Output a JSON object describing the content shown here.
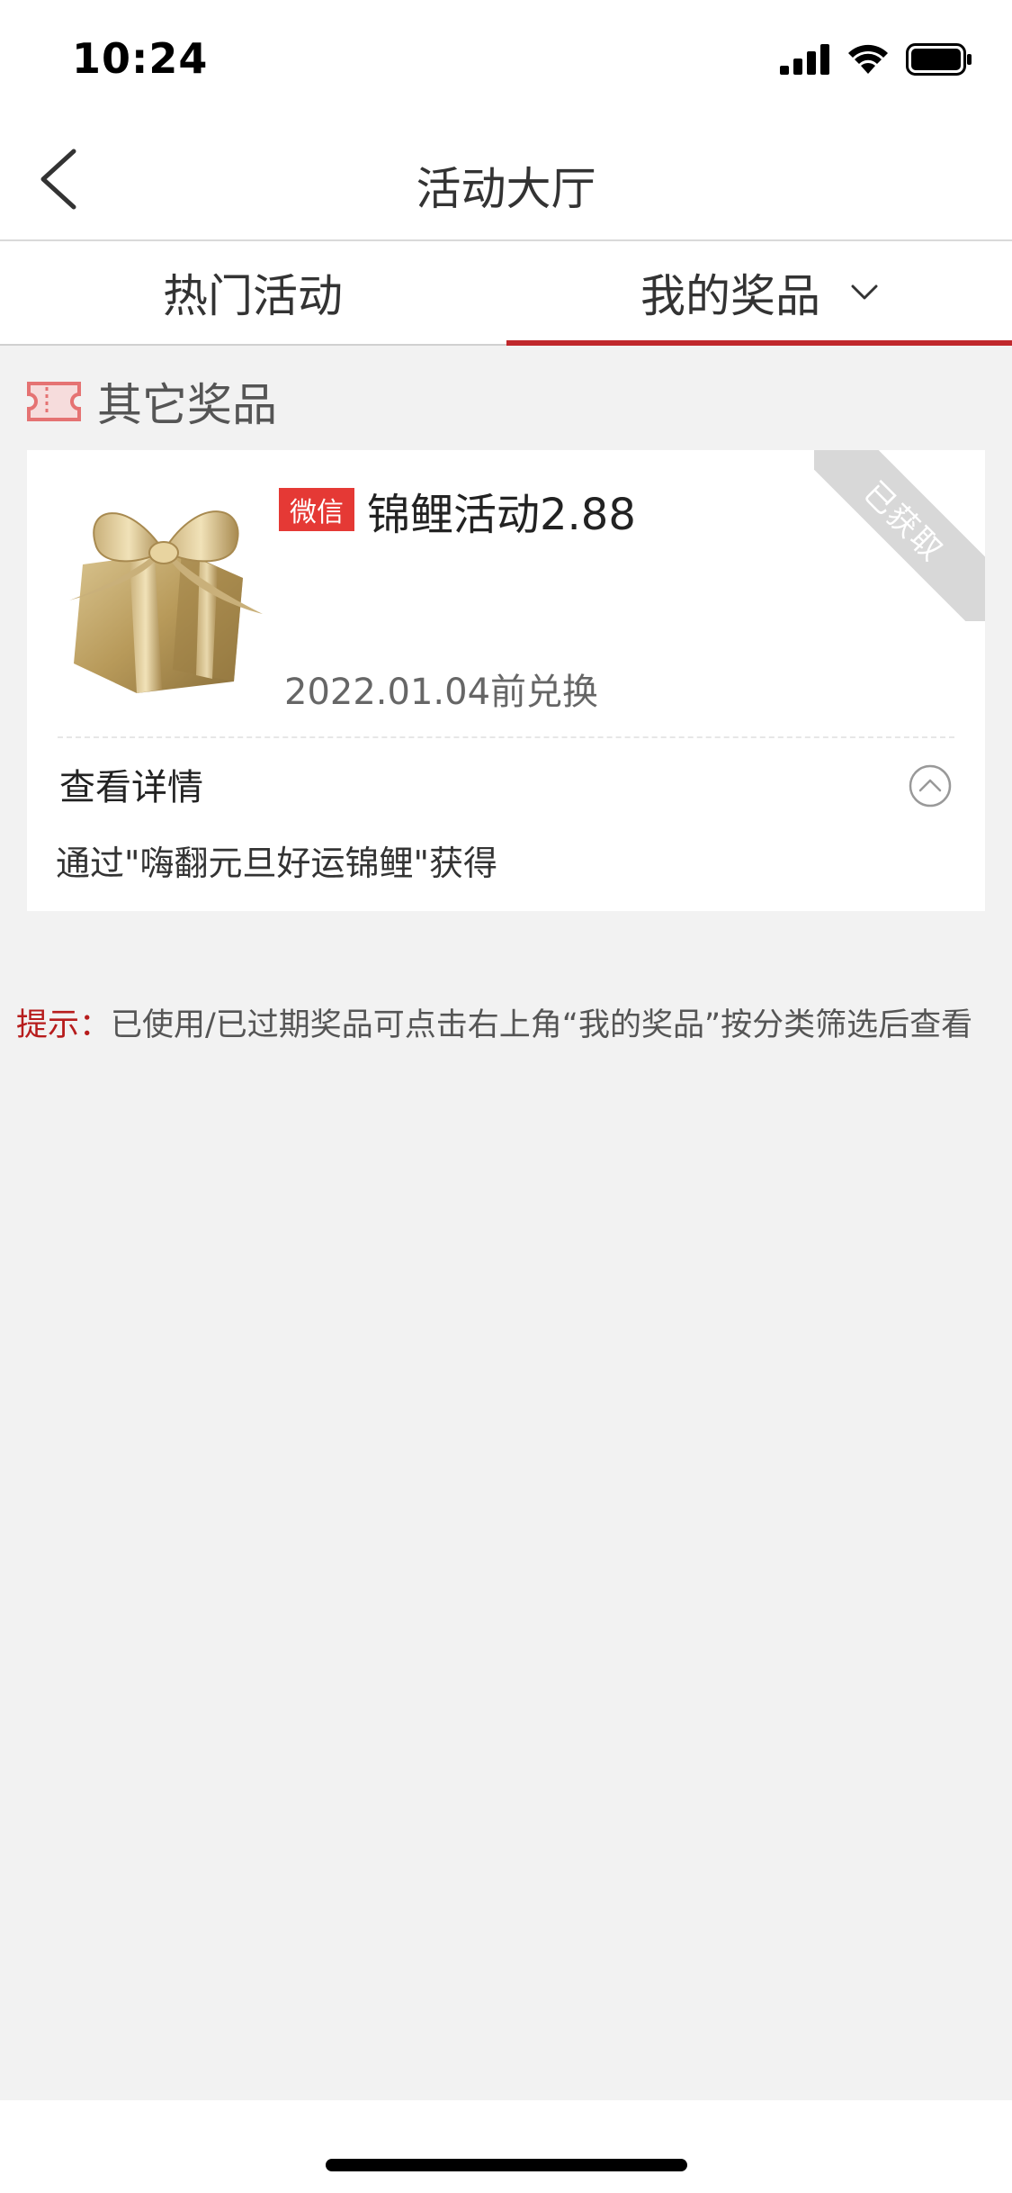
{
  "status_bar": {
    "time": "10:24"
  },
  "nav": {
    "title": "活动大厅",
    "back_icon": "chevron-left-icon"
  },
  "tabs": [
    {
      "label": "热门活动",
      "active": false
    },
    {
      "label": "我的奖品",
      "active": true,
      "icon": "chevron-down-icon"
    }
  ],
  "section": {
    "title": "其它奖品",
    "icon": "ticket-icon"
  },
  "prize": {
    "badge": "微信",
    "title": "锦鲤活动2.88",
    "deadline": "2022.01.04前兑换",
    "status_ribbon": "已获取",
    "detail_label": "查看详情",
    "detail_desc": "通过\"嗨翻元旦好运锦鲤\"获得",
    "image": "gift-box-image"
  },
  "tip": {
    "label": "提示：",
    "text": "已使用/已过期奖品可点击右上角“我的奖品”按分类筛选后查看"
  },
  "colors": {
    "accent": "#c0282c",
    "badge": "#e53935",
    "background": "#f2f2f2"
  }
}
